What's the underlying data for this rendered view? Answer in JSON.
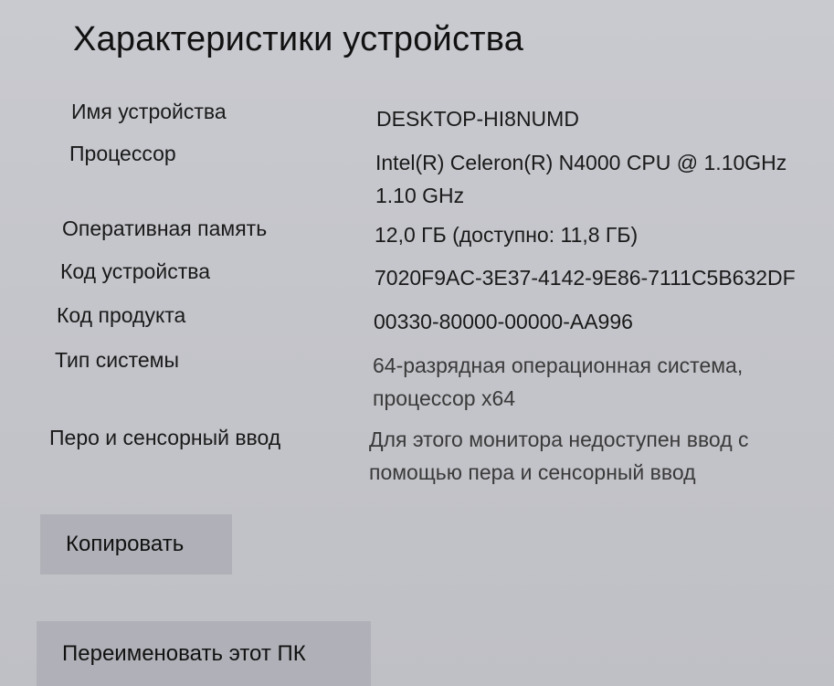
{
  "title": "Характеристики устройства",
  "specs": {
    "device_name": {
      "label": "Имя устройства",
      "value": "DESKTOP-HI8NUMD"
    },
    "processor": {
      "label": "Процессор",
      "value_line1": "Intel(R) Celeron(R) N4000 CPU @ 1.10GHz",
      "value_line2": "1.10 GHz"
    },
    "ram": {
      "label": "Оперативная память",
      "value": "12,0 ГБ (доступно: 11,8 ГБ)"
    },
    "device_id": {
      "label": "Код устройства",
      "value": "7020F9AC-3E37-4142-9E86-7111C5B632DF"
    },
    "product_id": {
      "label": "Код продукта",
      "value": "00330-80000-00000-AA996"
    },
    "system_type": {
      "label": "Тип системы",
      "value_line1": "64-разрядная операционная система,",
      "value_line2": "процессор x64"
    },
    "pen_touch": {
      "label": "Перо и сенсорный ввод",
      "value_line1": "Для этого монитора недоступен ввод с",
      "value_line2": "помощью пера и сенсорный ввод"
    }
  },
  "buttons": {
    "copy": "Копировать",
    "rename": "Переименовать этот ПК"
  }
}
